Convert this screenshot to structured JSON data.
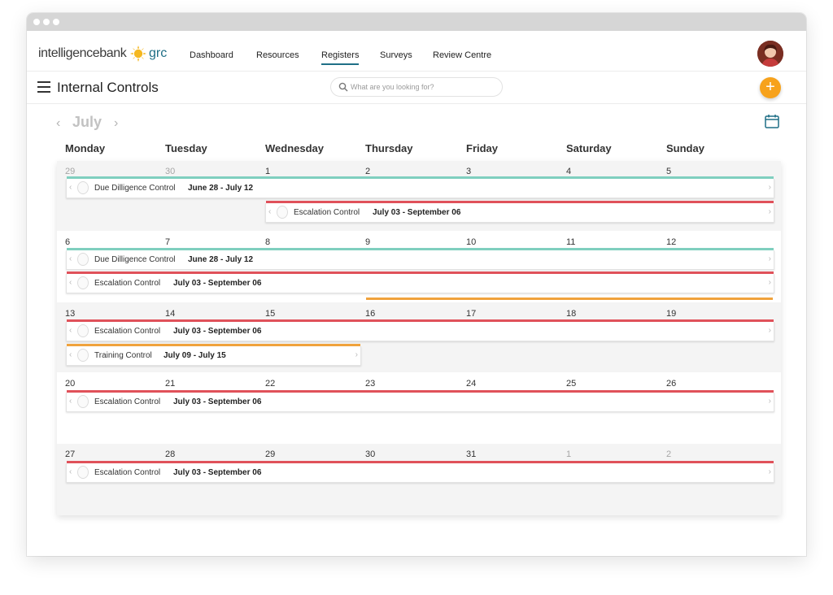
{
  "app": {
    "logo_text": "intelligencebank",
    "logo_suffix": "grc",
    "nav": [
      "Dashboard",
      "Resources",
      "Registers",
      "Surveys",
      "Review Centre"
    ],
    "active_nav": "Registers"
  },
  "page": {
    "title": "Internal Controls",
    "search_placeholder": "What are you looking for?",
    "add_label": "+"
  },
  "calendar": {
    "month": "July",
    "weekdays": [
      "Monday",
      "Tuesday",
      "Wednesday",
      "Thursday",
      "Friday",
      "Saturday",
      "Sunday"
    ],
    "weeks": [
      [
        "29",
        "30",
        "1",
        "2",
        "3",
        "4",
        "5"
      ],
      [
        "6",
        "7",
        "8",
        "9",
        "10",
        "11",
        "12"
      ],
      [
        "13",
        "14",
        "15",
        "16",
        "17",
        "18",
        "19"
      ],
      [
        "20",
        "21",
        "22",
        "23",
        "24",
        "25",
        "26"
      ],
      [
        "27",
        "28",
        "29",
        "30",
        "31",
        "1",
        "2"
      ]
    ]
  },
  "events": {
    "due_diligence": {
      "name": "Due Dilligence Control",
      "dates": "June 28 - July 12",
      "color": "#7fcfbf"
    },
    "escalation": {
      "name": "Escalation Control",
      "dates": "July 03 - September 06",
      "color": "#e0515a"
    },
    "training": {
      "name": "Training Control",
      "dates": "July 09 - July 15",
      "color": "#f0a23c"
    }
  }
}
